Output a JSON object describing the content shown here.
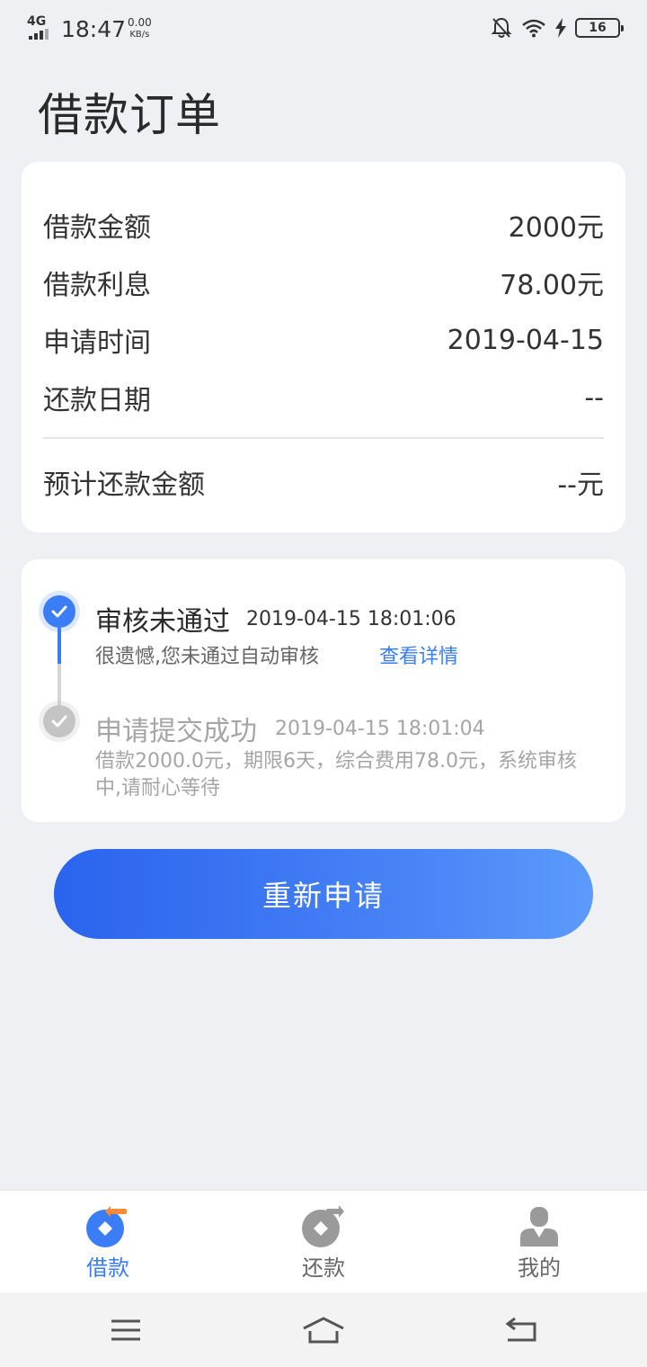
{
  "status_bar": {
    "network": "4G",
    "time": "18:47",
    "speed_value": "0.00",
    "speed_unit": "KB/s",
    "battery": "16"
  },
  "page": {
    "title": "借款订单"
  },
  "loan_details": [
    {
      "label": "借款金额",
      "value": "2000元"
    },
    {
      "label": "借款利息",
      "value": "78.00元"
    },
    {
      "label": "申请时间",
      "value": "2019-04-15"
    },
    {
      "label": "还款日期",
      "value": "--"
    }
  ],
  "expected_repayment": {
    "label": "预计还款金额",
    "value": "--元"
  },
  "timeline": [
    {
      "title": "审核未通过",
      "time": "2019-04-15 18:01:06",
      "desc": "很遗憾,您未通过自动审核",
      "link": "查看详情",
      "status": "active"
    },
    {
      "title": "申请提交成功",
      "time": "2019-04-15 18:01:04",
      "desc": "借款2000.0元，期限6天，综合费用78.0元，系统审核中,请耐心等待",
      "status": "inactive"
    }
  ],
  "actions": {
    "reapply": "重新申请"
  },
  "bottom_nav": [
    {
      "label": "借款",
      "icon": "loan-icon",
      "active": true
    },
    {
      "label": "还款",
      "icon": "repay-icon",
      "active": false
    },
    {
      "label": "我的",
      "icon": "profile-icon",
      "active": false
    }
  ],
  "colors": {
    "accent": "#3a7df6",
    "background": "#eef0f4",
    "muted": "#a5a5a5"
  }
}
